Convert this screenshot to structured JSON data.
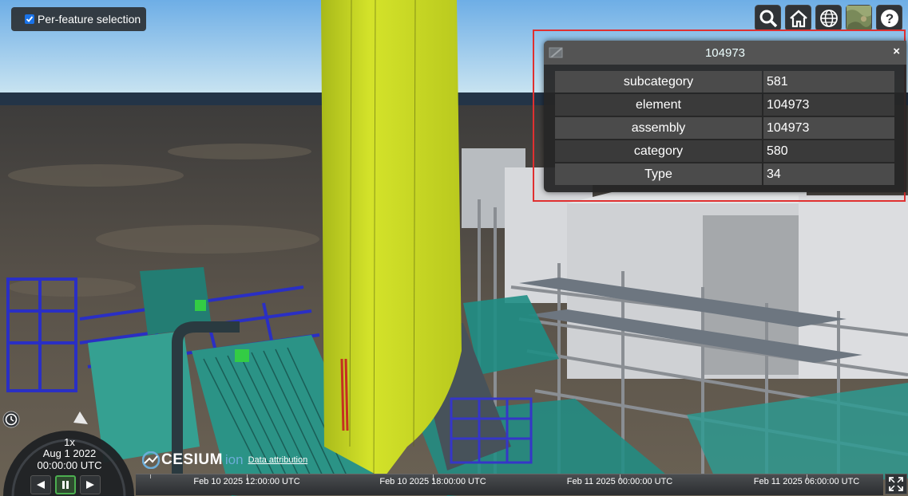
{
  "per_feature": {
    "label": "Per-feature selection",
    "checked": true
  },
  "toolbar": {
    "buttons": [
      {
        "name": "search-icon"
      },
      {
        "name": "home-icon"
      },
      {
        "name": "globe-icon"
      },
      {
        "name": "base-layer-icon"
      },
      {
        "name": "help-icon"
      }
    ],
    "help_glyph": "?"
  },
  "infobox": {
    "title": "104973",
    "close": "×",
    "rows": [
      {
        "key": "subcategory",
        "value": "581"
      },
      {
        "key": "element",
        "value": "104973"
      },
      {
        "key": "assembly",
        "value": "104973"
      },
      {
        "key": "category",
        "value": "580"
      },
      {
        "key": "Type",
        "value": "34"
      }
    ],
    "highlight_color": "#e03030"
  },
  "animation": {
    "speed": "1x",
    "date": "Aug 1 2022",
    "time": "00:00:00 UTC",
    "accent_color": "#4caf50"
  },
  "credit": {
    "logo": "CESIUM",
    "ion": "ion",
    "attribution": "Data attribution"
  },
  "timeline": {
    "labels": [
      "Feb 10 2025 12:00:00 UTC",
      "Feb 10 2025 18:00:00 UTC",
      "Feb 11 2025 00:00:00 UTC",
      "Feb 11 2025 06:00:00 UTC"
    ]
  },
  "colors": {
    "sky_top": "#7fb6e8",
    "sea": "#4a4640",
    "yellow_tower": "#c8da1f",
    "steel_blue": "#2233aa",
    "teal": "#2a8a80",
    "panel_bg": "#303336"
  }
}
